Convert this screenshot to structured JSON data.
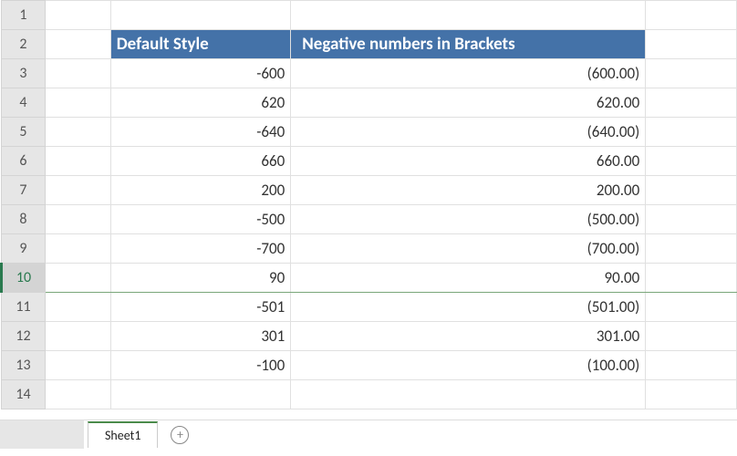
{
  "columns": {
    "b_header": "Default Style",
    "c_header": "Negative numbers in Brackets"
  },
  "rows": [
    {
      "num": "1",
      "b": "",
      "c": "",
      "neg": false
    },
    {
      "num": "2",
      "b": "",
      "c": "",
      "neg": false,
      "is_header": true
    },
    {
      "num": "3",
      "b": "-600",
      "c": "(600.00)",
      "neg": true
    },
    {
      "num": "4",
      "b": "620",
      "c": "620.00",
      "neg": false
    },
    {
      "num": "5",
      "b": "-640",
      "c": "(640.00)",
      "neg": true
    },
    {
      "num": "6",
      "b": "660",
      "c": "660.00",
      "neg": false
    },
    {
      "num": "7",
      "b": "200",
      "c": "200.00",
      "neg": false
    },
    {
      "num": "8",
      "b": "-500",
      "c": "(500.00)",
      "neg": true
    },
    {
      "num": "9",
      "b": "-700",
      "c": "(700.00)",
      "neg": true
    },
    {
      "num": "10",
      "b": "90",
      "c": "90.00",
      "neg": false,
      "selected": true
    },
    {
      "num": "11",
      "b": "-501",
      "c": "(501.00)",
      "neg": true
    },
    {
      "num": "12",
      "b": "301",
      "c": "301.00",
      "neg": false
    },
    {
      "num": "13",
      "b": "-100",
      "c": "(100.00)",
      "neg": true
    },
    {
      "num": "14",
      "b": "",
      "c": "",
      "neg": false
    }
  ],
  "tabs": {
    "sheet1": "Sheet1",
    "add_label": "+"
  }
}
